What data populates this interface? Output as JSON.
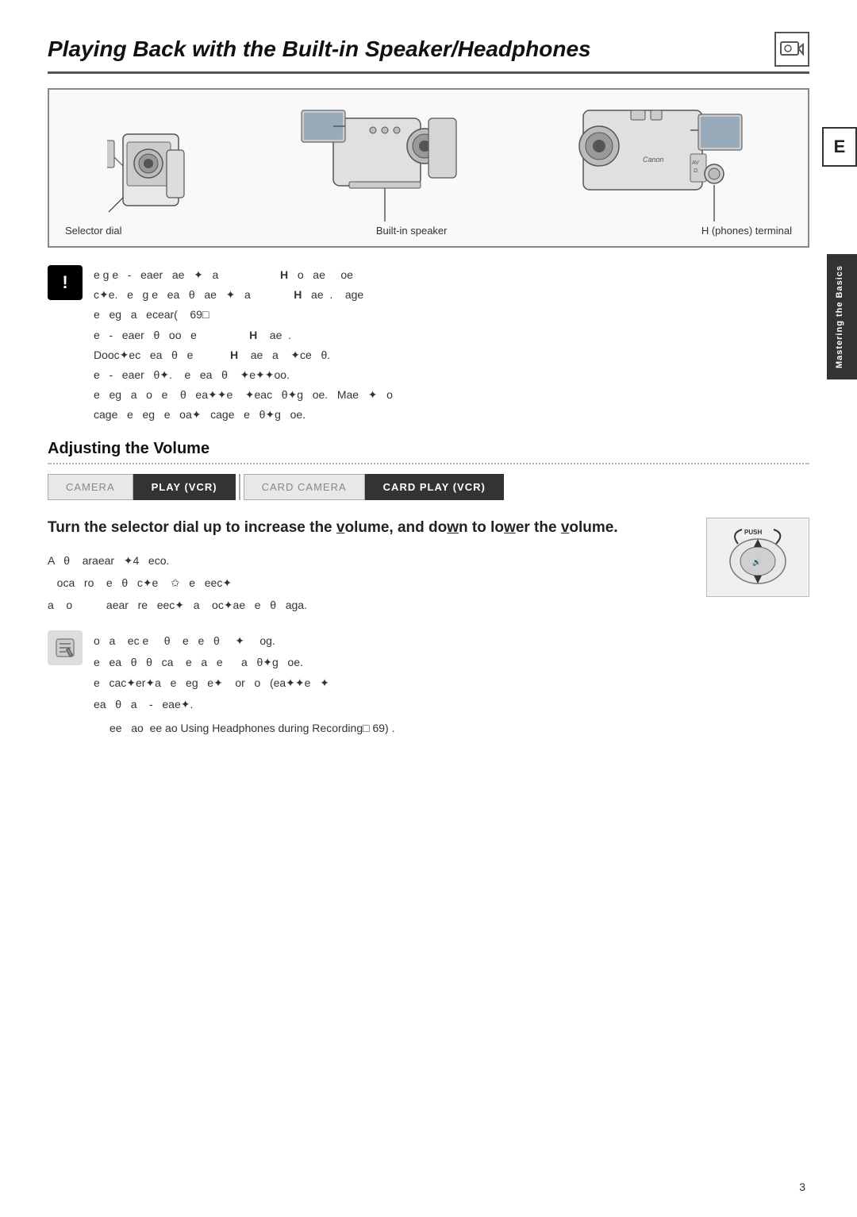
{
  "page": {
    "title": "Playing Back with the Built-in Speaker/Headphones",
    "page_number": "3",
    "title_icon": "▣",
    "e_tab": "E",
    "sidebar_label": "Mastering the Basics"
  },
  "diagram": {
    "label_left": "Selector dial",
    "label_center": "Built-in speaker",
    "label_right": "H (phones) terminal"
  },
  "warning": {
    "icon": "!",
    "lines": [
      "e g e  -  eaer  ae  ✦  a                     H   o  ae    oe",
      "c✦e.   e  g e  ea  θ   ae  ✦  a              H   ae  .   age",
      "e  eg  a  ecear(   69□",
      "e  -  eaer  θ  oo  e               H   ae  .",
      "Dooc✦ec  ea  θ  e               H   ae  a   ✦ce  θ.",
      "e  -  eaer  θ✦.   e  ea  θ   ✦e✦✦oo.",
      "e  eg  a  o  e   θ  ea✦✦e   ✦eac  θ✦g  oe.  Mae  ✦  o",
      "cage  e  eg  e  oa✦  cage  e  θ✦g  oe."
    ]
  },
  "adjusting_volume": {
    "heading": "Adjusting the Volume",
    "tabs": [
      {
        "label": "CAMERA",
        "state": "inactive"
      },
      {
        "label": "PLAY (VCR)",
        "state": "active"
      },
      {
        "label": "CARD CAMERA",
        "state": "inactive"
      },
      {
        "label": "CARD PLAY (VCR)",
        "state": "active"
      }
    ],
    "instruction_heading": "Turn the selector dial up to increase the volume, and down to lower the volume.",
    "instruction_lines": [
      "A  θ   araear  ✦4  eco.",
      "   oca  ro   e  θ  c✦e   ✩  e  eec✦",
      "a   o          aear  re  eec✦  a   oc✦ae  e  θ  aga."
    ]
  },
  "note": {
    "lines": [
      "o  a   ec e    θ   e  e  θ   ✦   og.",
      "e  ea  θ  θ  ca   e  a  e    a  θ✦g  oe.",
      "e  cac✦er✦a  e  eg  e✦   or  o  (ea✦✦e  ✦",
      "ea  θ  a   -  eae✦."
    ],
    "see_also": "ee  ao Using Headphones during Recording□  69) ."
  }
}
